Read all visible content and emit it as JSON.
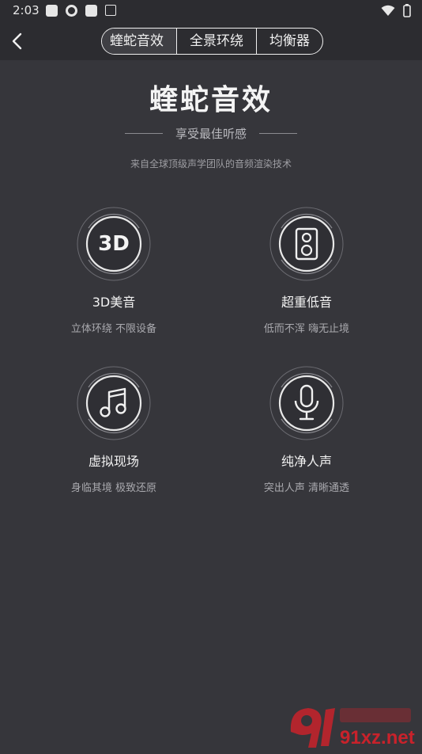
{
  "status": {
    "time": "2:03"
  },
  "tabs": [
    {
      "label": "蝰蛇音效",
      "active": true
    },
    {
      "label": "全景环绕",
      "active": false
    },
    {
      "label": "均衡器",
      "active": false
    }
  ],
  "hero": {
    "title": "蝰蛇音效",
    "subtitle": "享受最佳听感",
    "caption": "来自全球顶级声学团队的音频渲染技术"
  },
  "features": [
    {
      "name": "3D美音",
      "desc": "立体环绕 不限设备",
      "icon": "3d-text-icon",
      "icon_text": "3D"
    },
    {
      "name": "超重低音",
      "desc": "低而不浑 嗨无止境",
      "icon": "speaker-icon"
    },
    {
      "name": "虚拟现场",
      "desc": "身临其境 极致还原",
      "icon": "music-note-icon"
    },
    {
      "name": "纯净人声",
      "desc": "突出人声 清晰通透",
      "icon": "microphone-icon"
    }
  ],
  "watermark": {
    "text": "91xz.net"
  },
  "colors": {
    "background": "#36363b",
    "bar": "#2c2c30",
    "watermark": "#c8222b"
  }
}
